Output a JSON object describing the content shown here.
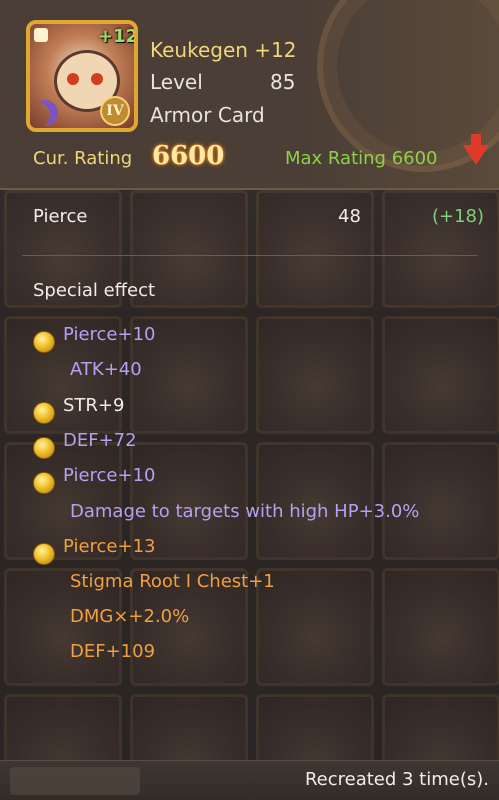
{
  "card": {
    "name": "Keukegen +12",
    "plus_badge": "+12",
    "tier": "IV",
    "level_label": "Level",
    "level_value": "85",
    "type": "Armor Card",
    "cur_rating_label": "Cur. Rating",
    "cur_rating_value": "6600",
    "max_rating_text": "Max Rating 6600"
  },
  "stat": {
    "label": "Pierce",
    "value": "48",
    "bonus": "(+18)"
  },
  "special_effect": {
    "title": "Special effect",
    "lines": [
      {
        "text": "Pierce+10",
        "color": "#b6a0f0",
        "coin": true
      },
      {
        "text": "ATK+40",
        "color": "#b6a0f0",
        "coin": false
      },
      {
        "text": "STR+9",
        "color": "#f2ede6",
        "coin": true
      },
      {
        "text": "DEF+72",
        "color": "#b6a0f0",
        "coin": true
      },
      {
        "text": "Pierce+10",
        "color": "#b6a0f0",
        "coin": true
      },
      {
        "text": "Damage to targets with high HP+3.0%",
        "color": "#b6a0f0",
        "coin": false
      },
      {
        "text": "Pierce+13",
        "color": "#f0a040",
        "coin": true
      },
      {
        "text": "Stigma Root I Chest+1",
        "color": "#f0a040",
        "coin": false
      },
      {
        "text": "DMG×+2.0%",
        "color": "#f0a040",
        "coin": false
      },
      {
        "text": "DEF+109",
        "color": "#f0a040",
        "coin": false
      }
    ]
  },
  "footer": {
    "recreated_text": "Recreated 3 time(s)."
  },
  "colors": {
    "gold": "#f1d57a",
    "green": "#8fd04a",
    "bonus_green": "#7fd07a",
    "purple": "#b6a0f0",
    "orange": "#f0a040"
  }
}
